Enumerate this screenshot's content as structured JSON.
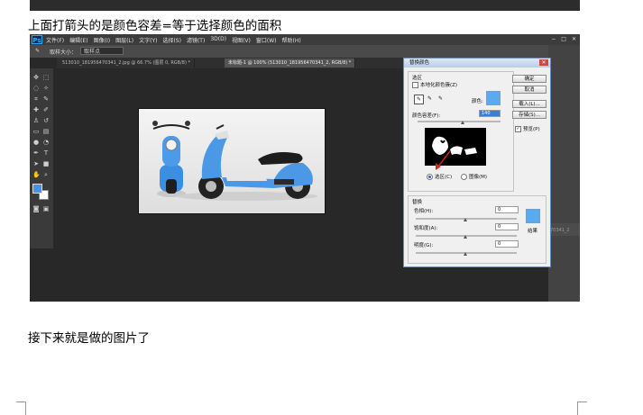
{
  "document": {
    "line1": "上面打箭头的是颜色容差=等于选择颜色的面积",
    "line2": "接下来就是做的图片了"
  },
  "photoshop": {
    "logo": "Ps",
    "menu": [
      "文件(F)",
      "编辑(E)",
      "图像(I)",
      "图层(L)",
      "文字(Y)",
      "选择(S)",
      "滤镜(T)",
      "3D(D)",
      "视图(V)",
      "窗口(W)",
      "帮助(H)"
    ],
    "window_buttons": [
      "−",
      "□",
      "✕"
    ],
    "options": {
      "tool_size_label": "取样大小：",
      "tool_size_value": "取样点"
    },
    "tabs": [
      "513010_181956470341_2.jpg @ 66.7% (图层 0, RGB/8) *",
      "未标题-1 @ 100% (513010_181956470341_2, RGB/8) *"
    ],
    "right_panel_label": "70341_2",
    "fg_color": "#4a90e2",
    "bg_color": "#ffffff"
  },
  "dialog": {
    "title": "替换颜色",
    "selection_group": "选区",
    "localized_clusters": "本地化颜色簇(Z)",
    "color_label": "颜色:",
    "fuzziness_label": "颜色容差(F):",
    "fuzziness_value": "140",
    "radio_selection": "选区(C)",
    "radio_image": "图像(M)",
    "replacement_group": "替换",
    "hue_label": "色相(H):",
    "hue_value": "0",
    "saturation_label": "饱和度(A):",
    "saturation_value": "0",
    "lightness_label": "明度(G):",
    "lightness_value": "0",
    "result_label": "结果",
    "ok": "确定",
    "cancel": "取消",
    "load": "载入(L)...",
    "save": "存储(S)...",
    "preview": "预览(P)",
    "selected_color": "#5aaaf0",
    "result_color": "#5aaaf0"
  }
}
